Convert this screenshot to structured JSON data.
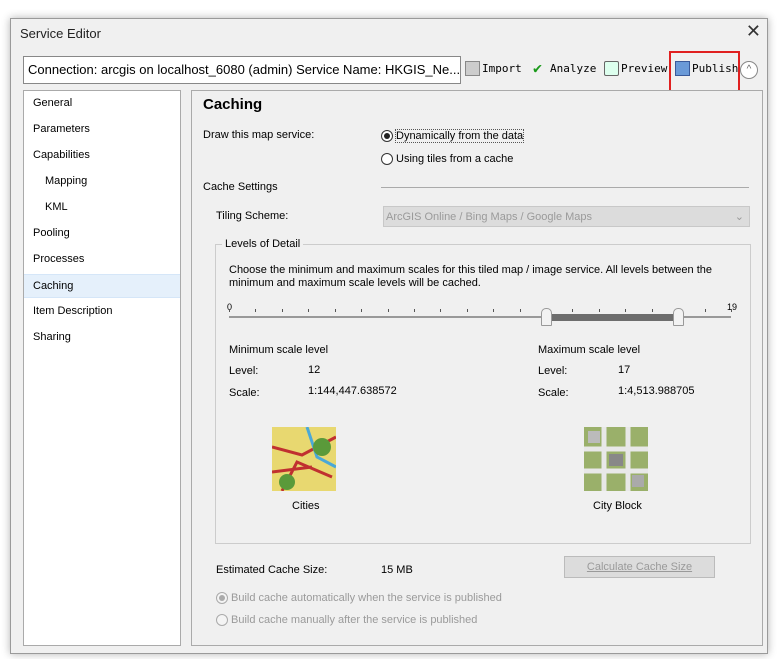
{
  "window": {
    "title": "Service Editor",
    "close": "✕"
  },
  "toolbar": {
    "connection": "Connection: arcgis on localhost_6080 (admin)   Service Name: HKGIS_Ne...",
    "import": "Import",
    "analyze": "Analyze",
    "preview": "Preview",
    "publish": "Publish",
    "collapse": "^"
  },
  "sidebar": {
    "items": [
      {
        "label": "General"
      },
      {
        "label": "Parameters"
      },
      {
        "label": "Capabilities"
      },
      {
        "label": "Mapping"
      },
      {
        "label": "KML"
      },
      {
        "label": "Pooling"
      },
      {
        "label": "Processes"
      },
      {
        "label": "Caching"
      },
      {
        "label": "Item Description"
      },
      {
        "label": "Sharing"
      }
    ],
    "selected": "Caching"
  },
  "caching": {
    "heading": "Caching",
    "draw_label": "Draw this map service:",
    "draw_options": [
      {
        "label": "Dynamically from the data",
        "selected": true
      },
      {
        "label": "Using tiles from a cache",
        "selected": false
      }
    ],
    "cache_settings": "Cache Settings",
    "tiling_label": "Tiling Scheme:",
    "tiling_value": "ArcGIS Online / Bing Maps / Google Maps",
    "lod_title": "Levels of Detail",
    "lod_desc": "Choose the minimum and maximum scales for this tiled map / image service. All levels between the minimum and maximum scale levels will be cached.",
    "slider": {
      "min": "0",
      "max": "19",
      "low": 12,
      "high": 17
    },
    "min_title": "Minimum scale level",
    "max_title": "Maximum scale level",
    "level_label": "Level:",
    "scale_label": "Scale:",
    "min_level": "12",
    "min_scale": "1:144,447.638572",
    "max_level": "17",
    "max_scale": "1:4,513.988705",
    "min_image_label": "Cities",
    "max_image_label": "City Block",
    "est_label": "Estimated Cache Size:",
    "est_value": "15 MB",
    "calc_button": "Calculate Cache Size",
    "build_options": [
      {
        "label": "Build cache automatically when the service is published",
        "selected": true
      },
      {
        "label": "Build cache manually after the service is published",
        "selected": false
      }
    ]
  }
}
